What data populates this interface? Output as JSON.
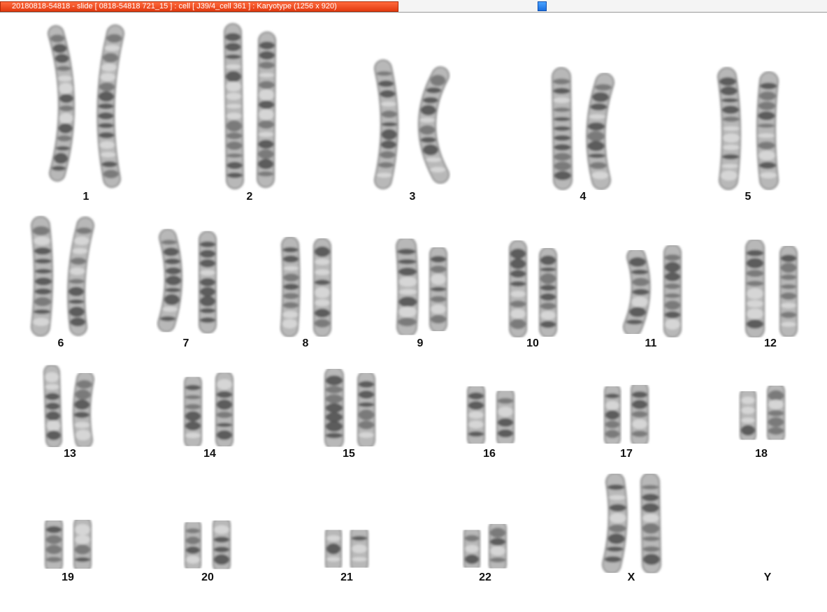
{
  "window": {
    "title": "20180818-54818 - slide [ 0818-54818 721_15 ] : cell [ J39/4_cell 361 ] : Karyotype  (1256 x 920)"
  },
  "chromosomes": [
    {
      "label": "1"
    },
    {
      "label": "2"
    },
    {
      "label": "3"
    },
    {
      "label": "4"
    },
    {
      "label": "5"
    },
    {
      "label": "6"
    },
    {
      "label": "7"
    },
    {
      "label": "8"
    },
    {
      "label": "9"
    },
    {
      "label": "10"
    },
    {
      "label": "11"
    },
    {
      "label": "12"
    },
    {
      "label": "13"
    },
    {
      "label": "14"
    },
    {
      "label": "15"
    },
    {
      "label": "16"
    },
    {
      "label": "17"
    },
    {
      "label": "18"
    },
    {
      "label": "19"
    },
    {
      "label": "20"
    },
    {
      "label": "21"
    },
    {
      "label": "22"
    },
    {
      "label": "X"
    },
    {
      "label": "Y"
    }
  ]
}
